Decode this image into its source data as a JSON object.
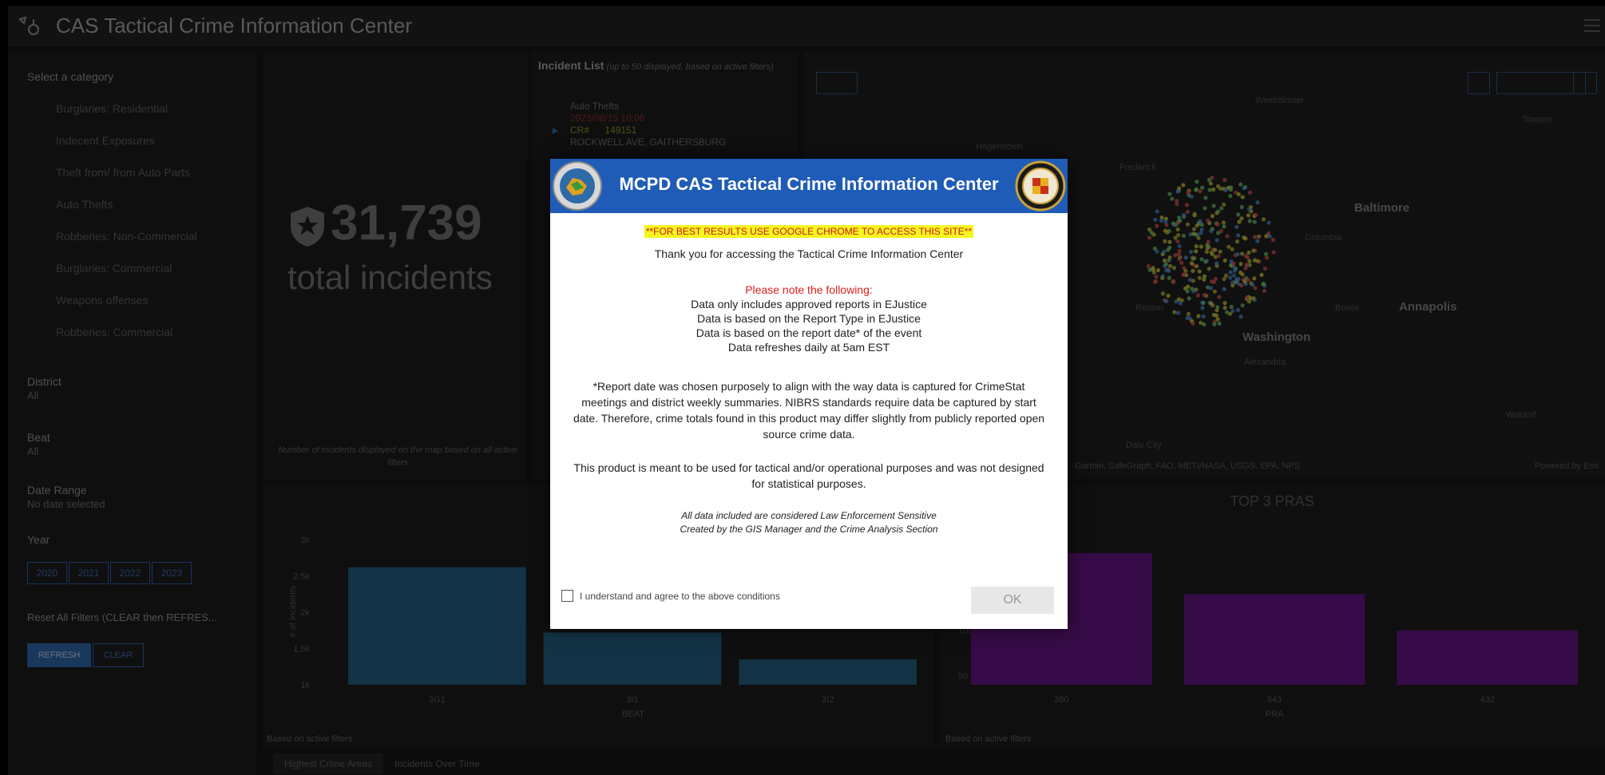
{
  "app": {
    "title": "CAS Tactical Crime Information Center"
  },
  "sidebar": {
    "category_label": "Select a category",
    "categories": [
      "Burglaries: Residential",
      "Indecent Exposures",
      "Theft from/ from Auto Parts",
      "Auto Thefts",
      "Robberies: Non-Commercial",
      "Burglaries: Commercial",
      "Weapons offenses",
      "Robberies: Commercial"
    ],
    "district_label": "District",
    "district_value": "All",
    "beat_label": "Beat",
    "beat_value": "All",
    "date_range_label": "Date Range",
    "date_range_value": "No date selected",
    "year_label": "Year",
    "years": [
      "2020",
      "2021",
      "2022",
      "2023"
    ],
    "reset_label": "Reset All Filters (CLEAR then REFRES...",
    "refresh_label": "REFRESH",
    "clear_label": "CLEAR"
  },
  "total": {
    "count": "31,739",
    "label": "total incidents",
    "note": "Number of incidents displayed on the map based on all active filters"
  },
  "incident_list": {
    "title": "Incident List",
    "subtitle": "(up to 50 displayed, based on active filters)",
    "first_item": {
      "type": "Auto Thefts",
      "date": "2023/08/15 10:06",
      "cr_label": "CR#",
      "cr_number": "149151",
      "address": "ROCKWELL AVE, GAITHERSBURG"
    }
  },
  "map": {
    "places": {
      "baltimore": "Baltimore",
      "annapolis": "Annapolis",
      "washington": "Washington",
      "frederick": "Frederick",
      "hagerstown": "Hagerstown",
      "columbia": "Columbia",
      "bowie": "Bowie",
      "reston": "Reston",
      "dale_city": "Dale City",
      "alexandria": "Alexandria",
      "towson": "Towson",
      "westminster": "Westminster",
      "waldorf": "Waldorf"
    },
    "attribution": "Garmin, SafeGraph, FAO, METI/NASA, USGS, EPA, NPS",
    "powered": "Powered by Esri"
  },
  "chart_beat": {
    "xlabel": "BEAT",
    "ylabel": "# of incidents",
    "yticks": [
      "3k",
      "2.5k",
      "2k",
      "1.5k",
      "1k"
    ],
    "categories": [
      "3G1",
      "3I1",
      "3I2"
    ],
    "values": [
      2620,
      1720,
      1350
    ],
    "color": "#1f5878",
    "based": "Based on active filters"
  },
  "chart_pra": {
    "title": "TOP 3 PRAS",
    "xlabel": "PRA",
    "yticks": [
      "100",
      "50"
    ],
    "categories": [
      "380",
      "543",
      "432"
    ],
    "values": [
      185,
      140,
      100
    ],
    "color": "#5e137a",
    "based": "Based on active filters"
  },
  "tabs": [
    "Highest Crime Areas",
    "Incidents Over Time"
  ],
  "modal": {
    "title": "MCPD CAS Tactical Crime Information Center",
    "warning": "**FOR BEST RESULTS USE GOOGLE CHROME TO ACCESS THIS SITE**",
    "thanks": "Thank you for accessing the Tactical Crime Information Center",
    "note_head": "Please note the following:",
    "notes": [
      "Data only includes approved reports in EJustice",
      "Data is based on the Report Type in EJustice",
      "Data is based on the report date* of the event",
      "Data refreshes daily at 5am EST"
    ],
    "report_date": "*Report date was chosen purposely to align with the way data is captured for CrimeStat meetings and district weekly summaries. NIBRS standards require data be captured by start date. Therefore, crime totals found in this product may differ slightly from publicly reported open source crime data.",
    "tactical": "This product is meant to be used for tactical and/or operational purposes and was not designed for statistical purposes.",
    "legal_1": "All data included are considered Law Enforcement Sensitive",
    "legal_2": "Created by the GIS Manager and the Crime Analysis Section",
    "agree_label": "I understand and agree to the above conditions",
    "ok_label": "OK",
    "header_color": "#1f5cb7"
  }
}
